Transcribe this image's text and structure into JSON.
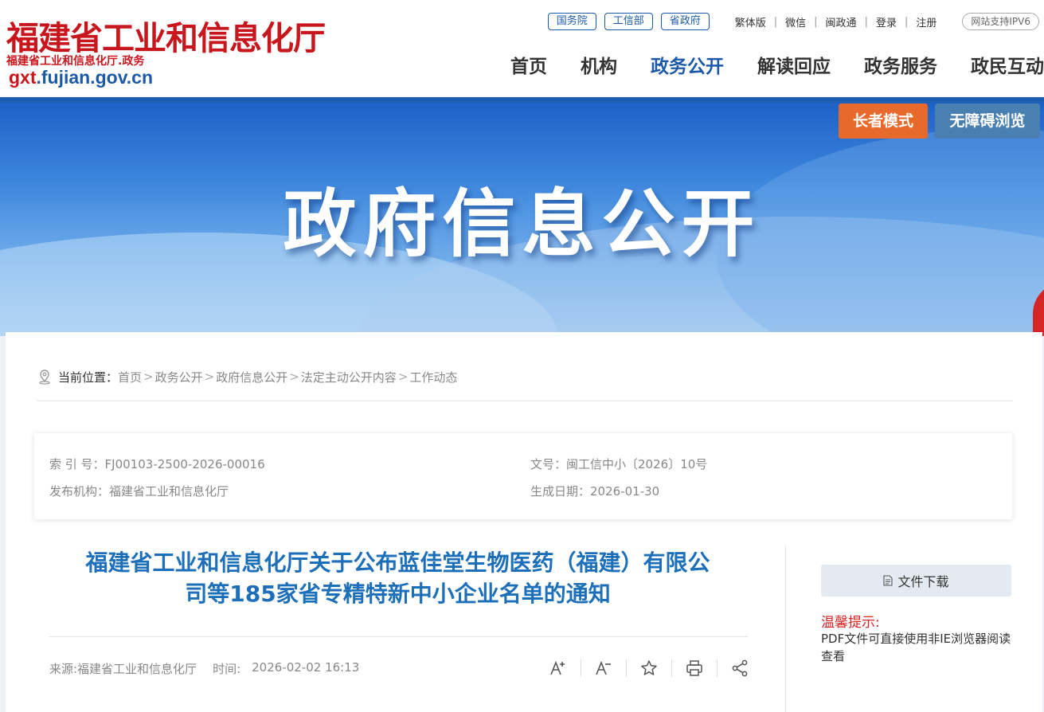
{
  "header": {
    "logo_title": "福建省工业和信息化厅",
    "logo_subtitle": "福建省工业和信息化厅.政务",
    "logo_domain_prefix": "gxt",
    "logo_domain_rest": ".fujian.gov.cn",
    "pills": [
      "国务院",
      "工信部",
      "省政府"
    ],
    "top_links": [
      "繁体版",
      "微信",
      "闽政通",
      "登录",
      "注册"
    ],
    "ipv6": "网站支持IPV6",
    "nav": [
      "首页",
      "机构",
      "政务公开",
      "解读回应",
      "政务服务",
      "政民互动"
    ],
    "nav_active": "政务公开"
  },
  "banner": {
    "title": "政府信息公开",
    "elder_mode": "长者模式",
    "accessible": "无障碍浏览"
  },
  "breadcrumb": {
    "label": "当前位置：",
    "items": [
      "首页",
      "政务公开",
      "政府信息公开",
      "法定主动公开内容",
      "工作动态"
    ],
    "separator": ">"
  },
  "meta": {
    "index_label": "索 引 号：",
    "index_value": "FJ00103-2500-2026-00016",
    "doc_label": "文号：",
    "doc_value": "闽工信中小〔2026〕10号",
    "org_label": "发布机构：",
    "org_value": "福建省工业和信息化厅",
    "date_label": "生成日期：",
    "date_value": "2026-01-30"
  },
  "article": {
    "title_line1": "福建省工业和信息化厅关于公布蓝佳堂生物医药（福建）有限公",
    "title_line2": "司等185家省专精特新中小企业名单的通知",
    "source": "来源:福建省工业和信息化厅",
    "time_label": "时间:",
    "time_value": "2026-02-02 16:13"
  },
  "tools": {
    "font_increase": "A+",
    "font_decrease": "A−"
  },
  "sidebar": {
    "download": "文件下载",
    "tip_title": "温馨提示:",
    "tip_text": "PDF文件可直接使用非IE浏览器阅读查看"
  },
  "colors": {
    "brand_red": "#c8161d",
    "brand_blue": "#1c5aa8",
    "title_blue": "#1c6fb8",
    "elder_orange": "#e76a2c"
  }
}
